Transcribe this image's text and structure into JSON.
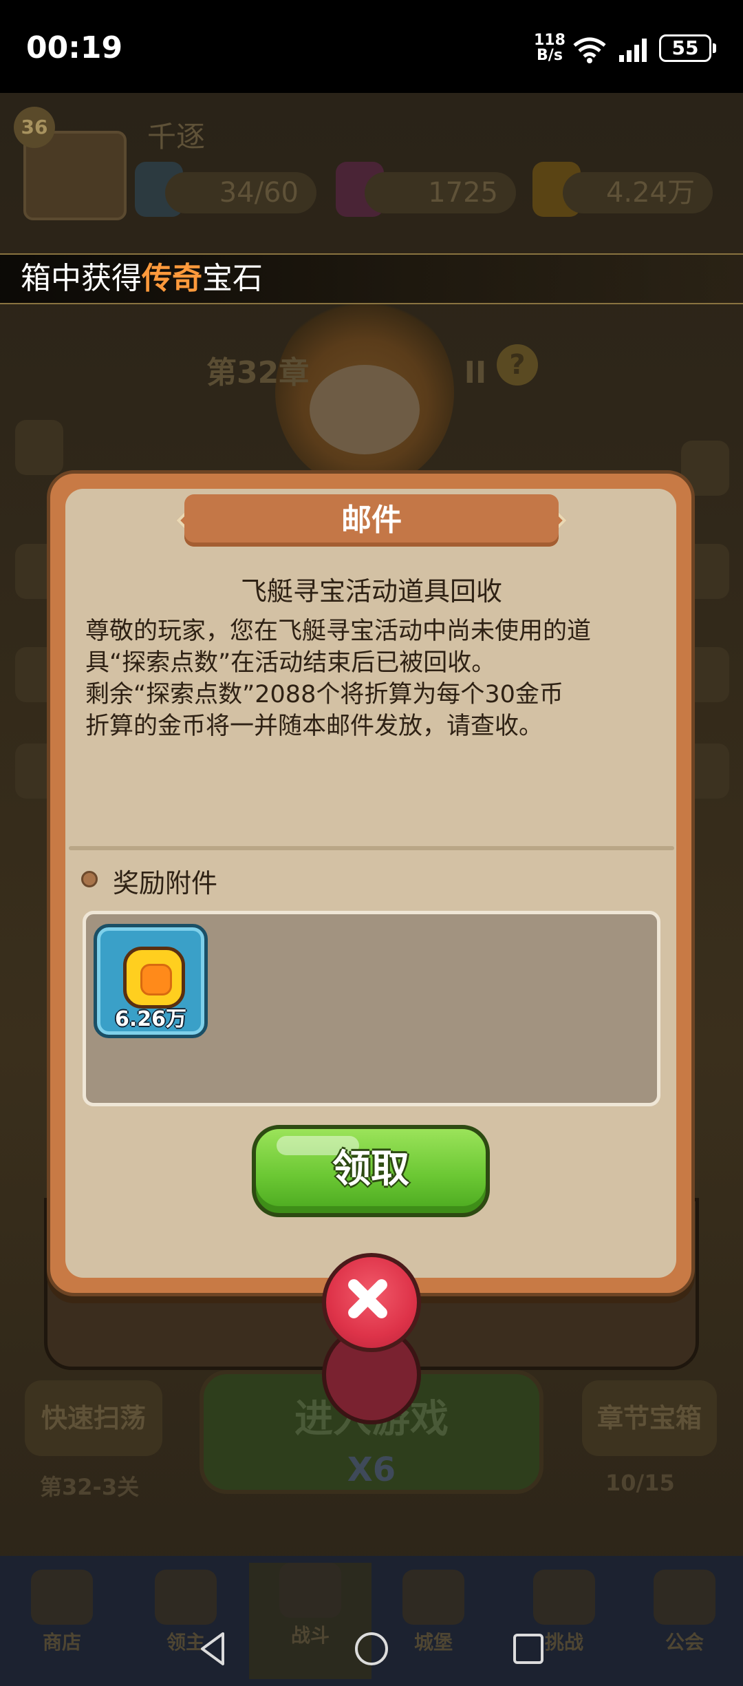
{
  "status_bar": {
    "time": "00:19",
    "net_speed_value": "118",
    "net_speed_unit": "B/s",
    "battery": "55"
  },
  "profile": {
    "level": "36",
    "name": "千逐",
    "stamina": "34/60",
    "gems": "1725",
    "gold": "4.24万"
  },
  "toast": {
    "prefix": "箱中获得",
    "highlight": "传奇",
    "suffix": "宝石",
    "highlight_color": "#ff9a3c"
  },
  "background": {
    "chapter": "第32章",
    "chapter_suffix": "II",
    "help": "?",
    "sweep_button": "快速扫荡",
    "stage": "第32-3关",
    "start_button": "进入游戏",
    "start_cost": "X6",
    "chest_button": "章节宝箱",
    "chest_progress": "10/15",
    "nav_tabs": [
      "商店",
      "领主",
      "战斗",
      "城堡",
      "挑战",
      "公会"
    ]
  },
  "dialog": {
    "title": "邮件",
    "subject": "飞艇寻宝活动道具回收",
    "body_lines": [
      "尊敬的玩家，您在飞艇寻宝活动中尚未使用的道",
      "具“探索点数”在活动结束后已被回收。",
      "剩余“探索点数”2088个将折算为每个30金币",
      "折算的金币将一并随本邮件发放，请查收。"
    ],
    "attachments_label": "奖励附件",
    "reward": {
      "icon": "gold-coin-icon",
      "amount": "6.26万"
    },
    "claim_button": "领取",
    "close_button_icon": "close-icon"
  },
  "colors": {
    "dialog_frame": "#c87a45",
    "dialog_panel": "#d3c1a4",
    "claim_green": "#6cc834",
    "close_red": "#de3349"
  }
}
